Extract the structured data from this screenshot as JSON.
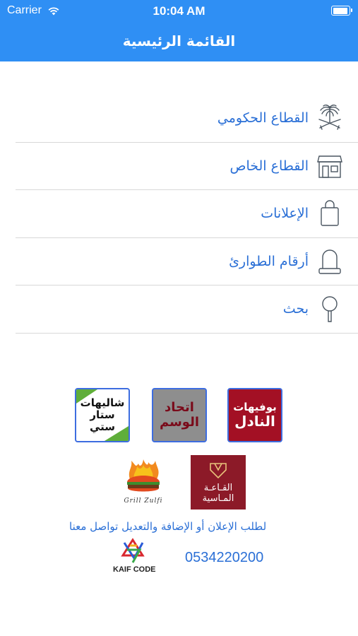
{
  "status_bar": {
    "carrier": "Carrier",
    "time": "10:04 AM"
  },
  "nav": {
    "title": "القائمة الرئيسية"
  },
  "menu": {
    "items": [
      {
        "label": "القطاع الحكومي",
        "icon": "palm-swords-icon"
      },
      {
        "label": "القطاع الخاص",
        "icon": "shop-icon"
      },
      {
        "label": "الإعلانات",
        "icon": "shopping-bag-icon"
      },
      {
        "label": "أرقام الطوارئ",
        "icon": "siren-icon"
      },
      {
        "label": "بحث",
        "icon": "search-icon"
      }
    ]
  },
  "sponsors": {
    "logo_a": {
      "line1": "بوفيهات",
      "line2": "النادل"
    },
    "logo_b": {
      "line1": "اتحاد",
      "line2": "الوسم"
    },
    "logo_c": {
      "line1": "شاليهات",
      "line2": "ستار ستي"
    },
    "logo_d": {
      "line1": "القـاعـة",
      "line2": "المـاسية"
    },
    "logo_e": {
      "text": "Grill Zulfi"
    }
  },
  "contact": {
    "text": "لطلب الإعلان أو الإضافة والتعديل تواصل معنا",
    "phone": "0534220200",
    "brand": "KAIF CODE"
  },
  "colors": {
    "nav_bg": "#2f8ff4",
    "accent": "#2a6fd6"
  }
}
